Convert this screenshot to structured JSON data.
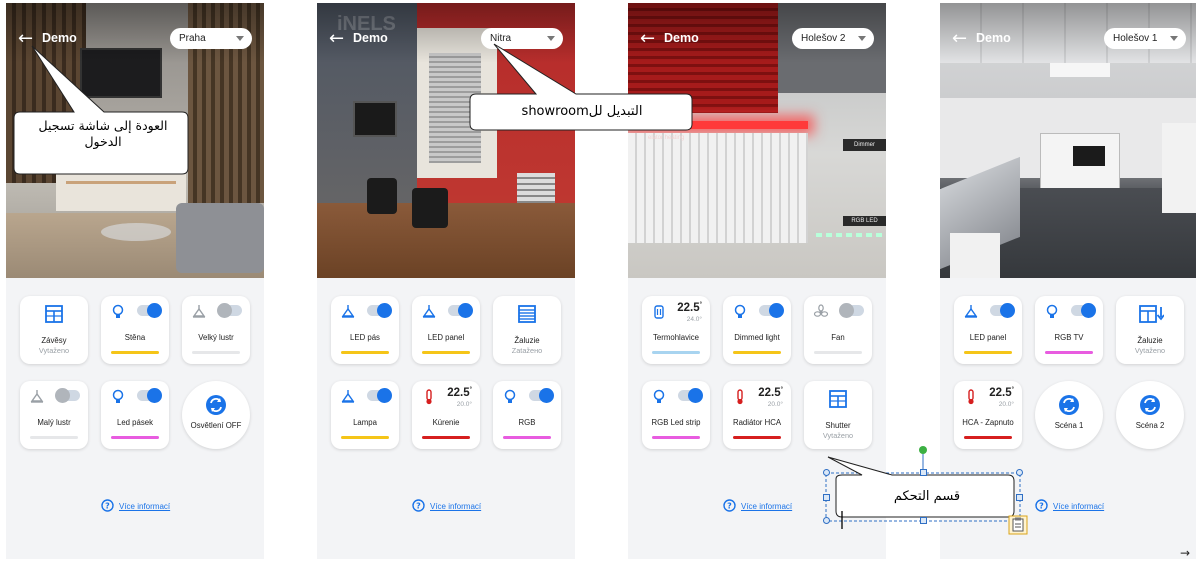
{
  "screens": [
    {
      "title": "Demo",
      "back_icon": "arrow-left-icon",
      "showroom": "Praha",
      "devices": [
        {
          "label": "Závěsy",
          "sub": "Vytaženo",
          "icon": "window-blind-icon"
        },
        {
          "label": "Stěna",
          "icon": "bulb-icon",
          "toggle": "on",
          "bar_color": "#f5c518"
        },
        {
          "label": "Velký lustr",
          "icon": "ceiling-lamp-icon",
          "toggle": "off",
          "bar_color": "#e6e7e9"
        },
        {
          "label": "Malý lustr",
          "icon": "ceiling-lamp-icon",
          "toggle": "off",
          "bar_color": "#e6e7e9"
        },
        {
          "label": "Led pásek",
          "icon": "bulb-icon",
          "toggle": "on",
          "bar_color": "#e85ce0"
        },
        {
          "label": "Osvětlení OFF",
          "icon": "scene-icon"
        }
      ],
      "more_info": "Více informací"
    },
    {
      "title": "Demo",
      "back_icon": "arrow-left-icon",
      "showroom": "Nitra",
      "devices": [
        {
          "label": "LED pás",
          "icon": "ceiling-lamp-icon",
          "toggle": "on",
          "bar_color": "#f5c518"
        },
        {
          "label": "LED panel",
          "icon": "ceiling-lamp-icon",
          "toggle": "on",
          "bar_color": "#f5c518"
        },
        {
          "label": "Žaluzie",
          "sub": "Zatažено",
          "icon": "blinds-icon"
        },
        {
          "label": "Lampa",
          "icon": "ceiling-lamp-icon",
          "toggle": "on",
          "bar_color": "#f5c518"
        },
        {
          "label": "Kúrenie",
          "icon": "thermometer-icon",
          "temp": "22.5",
          "setpoint": "20.0°",
          "bar_color": "#d61f1f"
        },
        {
          "label": "RGB",
          "icon": "bulb-icon",
          "toggle": "on",
          "bar_color": "#e85ce0"
        }
      ],
      "more_info": "Více informací"
    },
    {
      "title": "Demo",
      "back_icon": "arrow-left-icon",
      "showroom": "Holešov 2",
      "devices": [
        {
          "label": "Termohlavice",
          "icon": "radiator-valve-icon",
          "temp": "22.5",
          "setpoint": "24.0°",
          "bar_color": "#a8d4f0"
        },
        {
          "label": "Dimmed light",
          "icon": "bulb-icon",
          "toggle": "on",
          "bar_color": "#f5c518"
        },
        {
          "label": "Fan",
          "icon": "fan-icon",
          "toggle": "off",
          "bar_color": "#e6e7e9"
        },
        {
          "label": "RGB Led strip",
          "icon": "bulb-icon",
          "toggle": "on",
          "bar_color": "#e85ce0"
        },
        {
          "label": "Radiátor HCA",
          "icon": "thermometer-icon",
          "temp": "22.5",
          "setpoint": "20.0°",
          "bar_color": "#d61f1f"
        },
        {
          "label": "Shutter",
          "sub": "Vytaženo",
          "icon": "window-blind-icon"
        }
      ],
      "more_info": "Více informací"
    },
    {
      "title": "Demo",
      "back_icon": "arrow-left-icon",
      "showroom": "Holešov 1",
      "devices": [
        {
          "label": "LED panel",
          "icon": "ceiling-lamp-icon",
          "toggle": "on",
          "bar_color": "#f5c518"
        },
        {
          "label": "RGB TV",
          "icon": "bulb-icon",
          "toggle": "on",
          "bar_color": "#e85ce0"
        },
        {
          "label": "Žaluzie",
          "sub": "Vytaženo",
          "icon": "window-blind-down-icon"
        },
        {
          "label": "HCA - Zapnuto",
          "icon": "thermometer-icon",
          "temp": "22.5",
          "setpoint": "20.0°",
          "bar_color": "#d61f1f"
        },
        {
          "label": "Scéna 1",
          "icon": "scene-icon"
        },
        {
          "label": "Scéna 2",
          "icon": "scene-icon"
        }
      ],
      "more_info": "Více informací"
    }
  ],
  "annotations": {
    "back_callout": "العودة إلى شاشة تسجيل الدخول",
    "showroom_callout": "التبديل للshowroom",
    "control_callout": "قسم التحكم"
  },
  "colors": {
    "accent": "#1a73e8",
    "toggle_off": "#b0b5bb",
    "bar_yellow": "#f5c518",
    "bar_pink": "#e85ce0",
    "bar_red": "#d61f1f",
    "bar_lightblue": "#a8d4f0"
  },
  "corner_arrow": "→"
}
